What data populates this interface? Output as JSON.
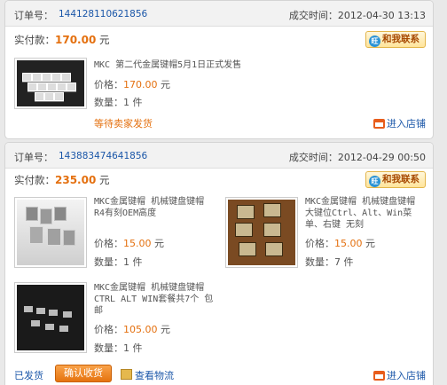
{
  "colors": {
    "accent": "#e4700f",
    "link": "#1a56a8"
  },
  "labels": {
    "order_no": "订单号：",
    "deal_time": "成交时间：",
    "paid": "实付款：",
    "yuan": "元",
    "chat": "和我联系",
    "price": "价格：",
    "qty": "数量：",
    "enter_shop": "进入店铺",
    "wait_ship": "等待卖家发货",
    "shipped": "已发货",
    "confirm": "确认收货",
    "logistics": "查看物流"
  },
  "orders": [
    {
      "order_no": "144128110621856",
      "time": "2012-04-30 13:13",
      "paid": "170.00",
      "items": [
        {
          "name": "MKC 第二代金属键帽5月1日正式发售",
          "price": "170.00",
          "qty": "1 件"
        }
      ]
    },
    {
      "order_no": "143883474641856",
      "time": "2012-04-29 00:50",
      "paid": "235.00",
      "items": [
        {
          "name": "MKC金属键帽 机械键盘键帽 R4有刻OEM高度",
          "price": "15.00",
          "qty": "1 件"
        },
        {
          "name": "MKC金属键帽 机械键盘键帽 大键位Ctrl、Alt、Win菜单、右键 无刻",
          "price": "15.00",
          "qty": "7 件"
        },
        {
          "name": "MKC金属键帽  机械键盘键帽 CTRL ALT WIN套餐共7个 包邮",
          "price": "105.00",
          "qty": "1 件"
        }
      ]
    }
  ]
}
